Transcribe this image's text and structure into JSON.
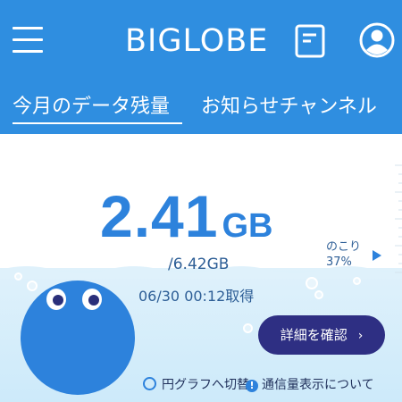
{
  "header": {
    "logo_text": "BIGLOBE",
    "tabs": [
      {
        "label": "今月のデータ残量",
        "active": true
      },
      {
        "label": "お知らせチャンネル",
        "active": false
      }
    ],
    "icons": [
      "hamburger-menu-icon",
      "document-icon",
      "user-icon"
    ]
  },
  "usage": {
    "remaining_value": "2.41",
    "remaining_unit": "GB",
    "total": "/6.42GB",
    "fetched_at": "06/30 00:12取得",
    "remain_label": "のこり",
    "remain_percent": "37%"
  },
  "actions": {
    "detail_button": "詳細を確認",
    "detail_chevron": "›",
    "graph_toggle": "円グラフへ切替",
    "usage_info": "通信量表示について",
    "info_mark": "!"
  },
  "colors": {
    "header_bg": "#2f8ee0",
    "accent_blue": "#2d82dc",
    "button_bg": "#2e2f83",
    "water_bg": "#dff1fb"
  }
}
